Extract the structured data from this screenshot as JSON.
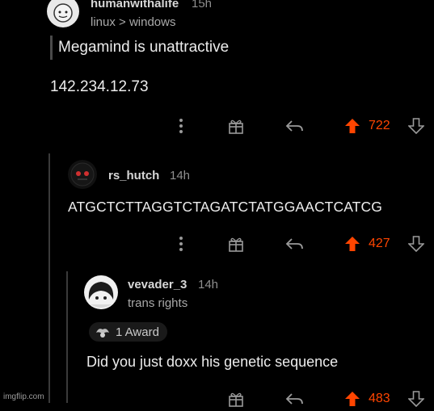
{
  "comments": [
    {
      "username": "humanwithalife",
      "time": "15h",
      "flair": "linux > windows",
      "quote": "Megamind is unattractive",
      "body": "142.234.12.73",
      "score": "722"
    },
    {
      "username": "rs_hutch",
      "time": "14h",
      "body": "ATGCTCTTAGGTCTAGATCTATGGAACTCATCG",
      "score": "427"
    },
    {
      "username": "vevader_3",
      "time": "14h",
      "flair": "trans rights",
      "award": "1 Award",
      "body": "Did you just doxx his genetic sequence",
      "score": "483"
    }
  ],
  "icons": {
    "more": "more-vert-icon",
    "award": "gift-award-icon",
    "reply": "reply-icon",
    "upvote": "upvote-icon",
    "downvote": "downvote-icon"
  },
  "colors": {
    "upvote": "#ff4500",
    "background": "#000000",
    "text": "#e6e6e6"
  },
  "watermark": "imgflip.com"
}
